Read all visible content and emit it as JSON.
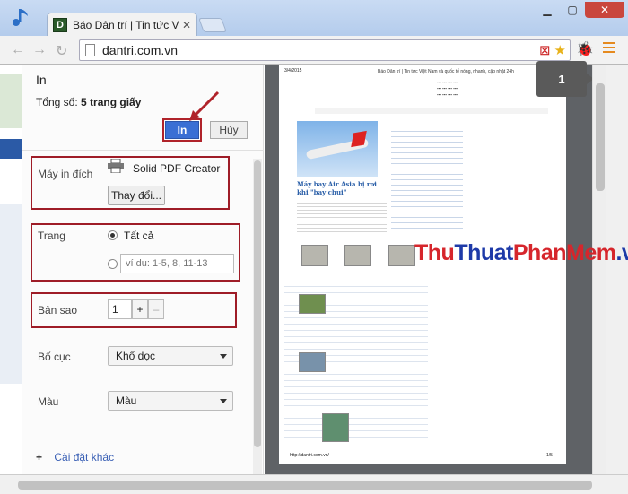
{
  "browser": {
    "tab_title": "Báo Dân trí | Tin tức Việt N",
    "tab_favicon": "D",
    "url": "dantri.com.vn",
    "new_tab_icon": "new-tab-icon"
  },
  "print_dialog": {
    "title": "In",
    "total_label": "Tổng số:",
    "total_value": "5 trang giấy",
    "print_button": "In",
    "cancel_button": "Hủy",
    "destination_label": "Máy in đích",
    "printer_name": "Solid PDF Creator",
    "change_button": "Thay đổi...",
    "pages_label": "Trang",
    "pages_all": "Tất cả",
    "pages_range_placeholder": "ví dụ: 1-5, 8, 11-13",
    "copies_label": "Bản sao",
    "copies_value": "1",
    "copies_plus": "+",
    "copies_minus": "–",
    "layout_label": "Bố cục",
    "layout_value": "Khổ dọc",
    "color_label": "Màu",
    "color_value": "Màu",
    "more_settings": "Cài đặt khác",
    "more_settings_plus": "+"
  },
  "preview": {
    "page_date": "3/4/2015",
    "page_header": "Báo Dân trí | Tin tức Việt Nam và quốc tế nóng, nhanh, cập nhật 24h",
    "headline": "Máy bay Air Asia bị rơi khi \"bay chui\"",
    "footer_url": "http://dantri.com.vn/",
    "footer_page": "1/5",
    "page_badge": "1"
  },
  "watermark": {
    "part1": "Thu",
    "part2": "Thuat",
    "part3": "PhanMem",
    "part4": ".vn"
  },
  "colors": {
    "accent_red": "#9e1c27",
    "print_blue": "#3a6fd4",
    "link_blue": "#3a60b5"
  }
}
